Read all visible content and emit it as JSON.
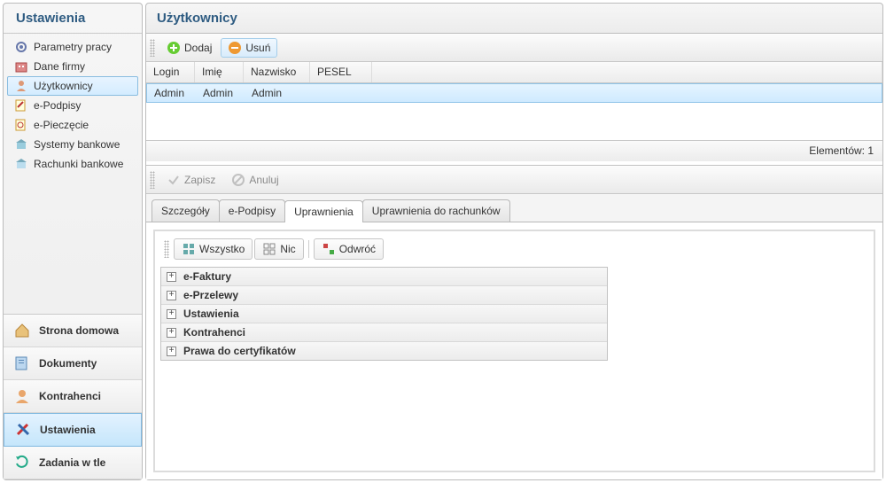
{
  "sidebar": {
    "title": "Ustawienia",
    "settings_items": [
      {
        "label": "Parametry pracy",
        "icon": "gear-icon"
      },
      {
        "label": "Dane firmy",
        "icon": "company-icon"
      },
      {
        "label": "Użytkownicy",
        "icon": "user-icon"
      },
      {
        "label": "e-Podpisy",
        "icon": "signature-icon"
      },
      {
        "label": "e-Pieczęcie",
        "icon": "stamp-icon"
      },
      {
        "label": "Systemy bankowe",
        "icon": "bank-system-icon"
      },
      {
        "label": "Rachunki bankowe",
        "icon": "bank-account-icon"
      }
    ],
    "settings_active_index": 2,
    "nav": [
      {
        "label": "Strona domowa",
        "icon": "home-icon"
      },
      {
        "label": "Dokumenty",
        "icon": "documents-icon"
      },
      {
        "label": "Kontrahenci",
        "icon": "partner-icon"
      },
      {
        "label": "Ustawienia",
        "icon": "settings-icon"
      },
      {
        "label": "Zadania w tle",
        "icon": "background-tasks-icon"
      }
    ],
    "nav_active_index": 3
  },
  "main": {
    "title": "Użytkownicy",
    "toolbar": {
      "add": "Dodaj",
      "del": "Usuń"
    },
    "grid": {
      "cols": {
        "login": "Login",
        "imie": "Imię",
        "nazwisko": "Nazwisko",
        "pesel": "PESEL"
      },
      "rows": [
        {
          "login": "Admin",
          "imie": "Admin",
          "nazwisko": "Admin",
          "pesel": ""
        }
      ],
      "footer": "Elementów: 1"
    },
    "sub_toolbar": {
      "save": "Zapisz",
      "cancel": "Anuluj"
    },
    "tabs": [
      "Szczegóły",
      "e-Podpisy",
      "Uprawnienia",
      "Uprawnienia do rachunków"
    ],
    "tabs_active_index": 2,
    "perm_toolbar": {
      "all": "Wszystko",
      "none": "Nic",
      "invert": "Odwróć"
    },
    "tree": [
      "e-Faktury",
      "e-Przelewy",
      "Ustawienia",
      "Kontrahenci",
      "Prawa do certyfikatów"
    ]
  }
}
